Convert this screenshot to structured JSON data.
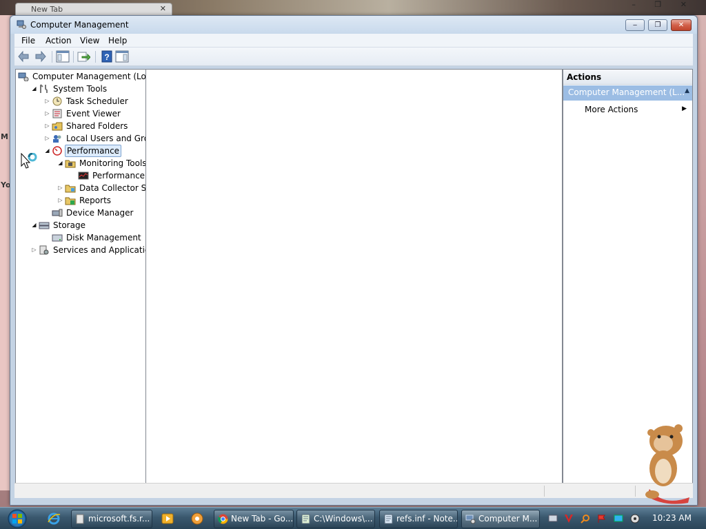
{
  "background": {
    "tab_label": "New Tab",
    "left_edge_letters": [
      "M",
      "Yo"
    ]
  },
  "window": {
    "title": "Computer Management",
    "buttons": {
      "minimize": "‒",
      "maximize": "❐",
      "close": "✕"
    }
  },
  "menu": [
    "File",
    "Action",
    "View",
    "Help"
  ],
  "tree": [
    {
      "label": "Computer Management (Local",
      "level": 0,
      "expander": "none",
      "icon": "computer-management-icon"
    },
    {
      "label": "System Tools",
      "level": 1,
      "expander": "expanded",
      "icon": "tools-icon"
    },
    {
      "label": "Task Scheduler",
      "level": 2,
      "expander": "collapsed",
      "icon": "clock-icon"
    },
    {
      "label": "Event Viewer",
      "level": 2,
      "expander": "collapsed",
      "icon": "event-viewer-icon"
    },
    {
      "label": "Shared Folders",
      "level": 2,
      "expander": "collapsed",
      "icon": "shared-folder-icon"
    },
    {
      "label": "Local Users and Groups",
      "level": 2,
      "expander": "collapsed",
      "icon": "users-icon"
    },
    {
      "label": "Performance",
      "level": 2,
      "expander": "expanded",
      "icon": "performance-icon",
      "selected": true
    },
    {
      "label": "Monitoring Tools",
      "level": 3,
      "expander": "expanded",
      "icon": "folder-icon"
    },
    {
      "label": "Performance Mc",
      "level": 4,
      "expander": "none",
      "icon": "performance-monitor-icon"
    },
    {
      "label": "Data Collector Sets",
      "level": 3,
      "expander": "collapsed",
      "icon": "data-collector-icon"
    },
    {
      "label": "Reports",
      "level": 3,
      "expander": "collapsed",
      "icon": "reports-icon"
    },
    {
      "label": "Device Manager",
      "level": 2,
      "expander": "none",
      "icon": "device-manager-icon"
    },
    {
      "label": "Storage",
      "level": 1,
      "expander": "expanded",
      "icon": "storage-icon"
    },
    {
      "label": "Disk Management",
      "level": 2,
      "expander": "none",
      "icon": "disk-icon"
    },
    {
      "label": "Services and Applications",
      "level": 1,
      "expander": "collapsed",
      "icon": "services-icon"
    }
  ],
  "actions": {
    "header": "Actions",
    "section": "Computer Management (L...",
    "items": [
      "More Actions"
    ]
  },
  "taskbar": {
    "buttons": [
      {
        "label": "microsoft.fs.r...",
        "icon": "file-icon"
      },
      {
        "label": "New Tab - Go...",
        "icon": "chrome-icon"
      },
      {
        "label": "C:\\Windows\\...",
        "icon": "notepad-icon"
      },
      {
        "label": "refs.inf - Note...",
        "icon": "notepad-icon"
      },
      {
        "label": "Computer M...",
        "icon": "computer-management-icon",
        "active": true
      }
    ],
    "clock": "10:23 AM"
  },
  "colors": {
    "selection": "#dcebfc",
    "actions_section": "#9cbde4",
    "taskbar": "#3a586e"
  }
}
